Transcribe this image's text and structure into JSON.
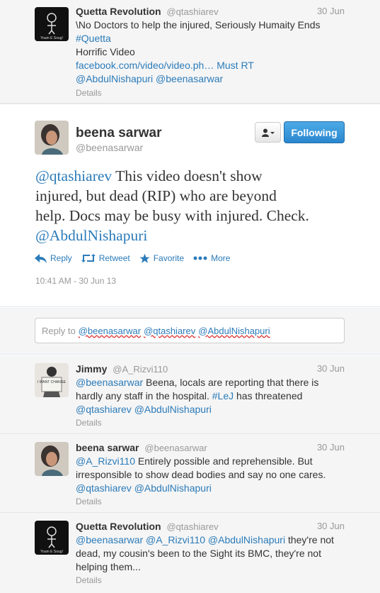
{
  "colors": {
    "link": "#2b7bb9",
    "muted": "#999999",
    "follow_button": "#2a87cf",
    "background_grey": "#f5f5f5"
  },
  "tweets_above": [
    {
      "name": "Quetta Revolution",
      "handle": "@qtashiarev",
      "time": "30 Jun",
      "lines": [
        "\\No Doctors to help the injured, Seriously Humaity Ends",
        "#Quetta",
        "Horrific Video",
        "facebook.com/video/video.ph… Must RT",
        "@AbdulNishapuri @beenasarwar"
      ],
      "details": "Details",
      "avatar_text": "Youm E Soug!"
    }
  ],
  "main_tweet": {
    "name": "beena sarwar",
    "handle": "@beenasarwar",
    "follow_label": "Following",
    "text_lines": [
      {
        "mention": "@qtashiarev",
        "rest": " This video doesn't show"
      },
      {
        "mention": "",
        "rest": "injured, but dead (RIP) who are beyond"
      },
      {
        "mention": "",
        "rest": "help. Docs may be busy with injured. Check."
      },
      {
        "mention": "@AbdulNishapuri",
        "rest": ""
      }
    ],
    "actions": {
      "reply": "Reply",
      "retweet": "Retweet",
      "favorite": "Favorite",
      "more": "More"
    },
    "timestamp": "10:41 AM - 30 Jun 13",
    "icons": [
      "user-dropdown-icon",
      "reply-icon",
      "retweet-icon",
      "star-icon",
      "more-dots-icon"
    ]
  },
  "reply_box": {
    "prefix": "Reply to",
    "mentions": [
      "@beenasarwar",
      "@qtashiarev",
      "@AbdulNishapuri"
    ]
  },
  "replies": [
    {
      "name": "Jimmy",
      "handle": "@A_Rizvi110",
      "time": "30 Jun",
      "lines": [
        [
          {
            "t": "@beenasarwar",
            "l": true
          },
          {
            "t": " Beena, locals are reporting that there is",
            "l": false
          }
        ],
        [
          {
            "t": "hardly any staff in the hospital. ",
            "l": false
          },
          {
            "t": "#LeJ",
            "l": true
          },
          {
            "t": " has threatened",
            "l": false
          }
        ],
        [
          {
            "t": "@qtashiarev @AbdulNishapuri",
            "l": true
          }
        ]
      ],
      "details": "Details",
      "avatar_text": "I WANT CHANGE"
    },
    {
      "name": "beena sarwar",
      "handle": "@beenasarwar",
      "time": "30 Jun",
      "lines": [
        [
          {
            "t": "@A_Rizvi110",
            "l": true
          },
          {
            "t": " Entirely possible and reprehensible. But",
            "l": false
          }
        ],
        [
          {
            "t": "irresponsible to show dead bodies and say no one cares.",
            "l": false
          }
        ],
        [
          {
            "t": "@qtashiarev @AbdulNishapuri",
            "l": true
          }
        ]
      ],
      "details": "Details",
      "avatar_text": ""
    },
    {
      "name": "Quetta Revolution",
      "handle": "@qtashiarev",
      "time": "30 Jun",
      "lines": [
        [
          {
            "t": "@beenasarwar @A_Rizvi110 @AbdulNishapuri",
            "l": true
          },
          {
            "t": " they're not",
            "l": false
          }
        ],
        [
          {
            "t": "dead, my cousin's been to the Sight its BMC, they're not",
            "l": false
          }
        ],
        [
          {
            "t": "helping them...",
            "l": false
          }
        ]
      ],
      "details": "Details",
      "avatar_text": "Youm E Soug!"
    }
  ]
}
